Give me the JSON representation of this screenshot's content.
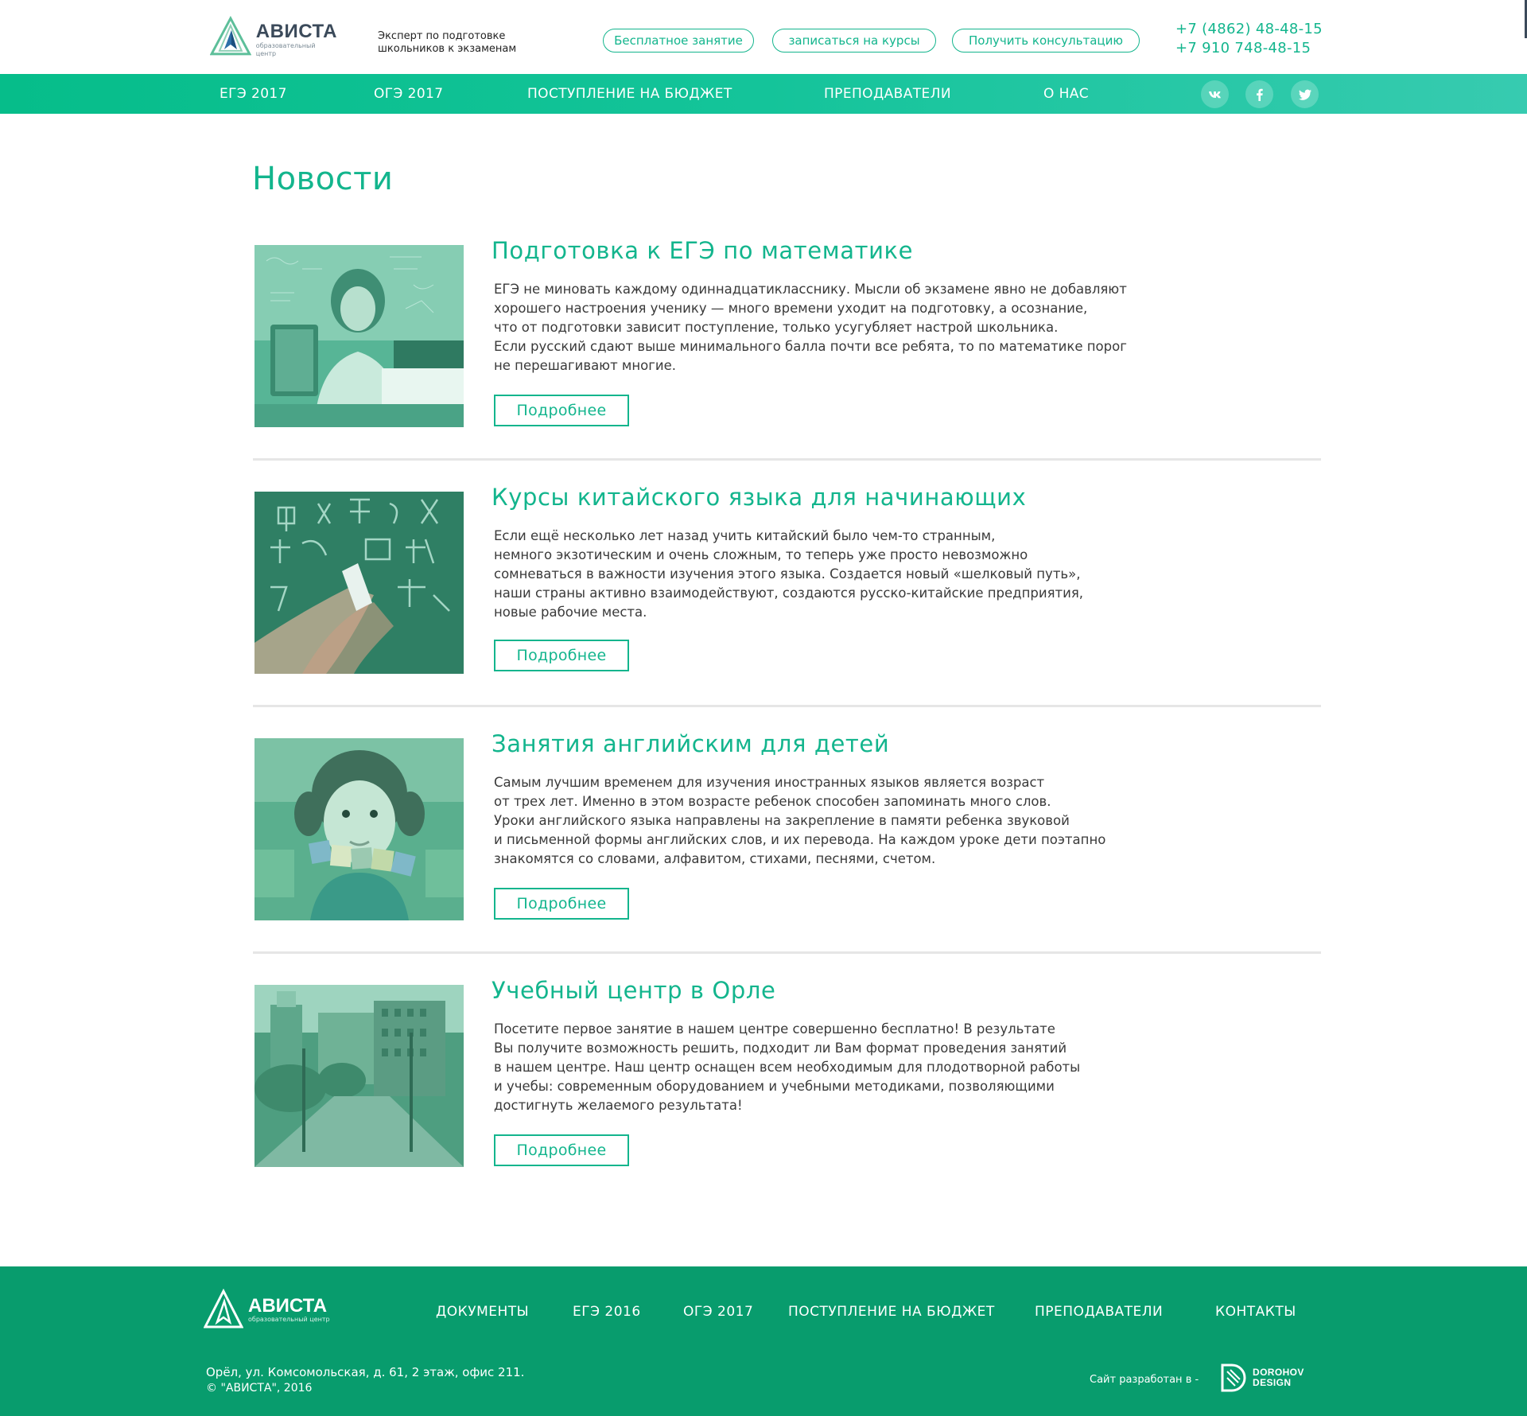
{
  "header": {
    "logo_name": "АВИСТА",
    "logo_sub": "образовательный центр",
    "tagline_line1": "Эксперт по подготовке",
    "tagline_line2": "школьников к экзаменам",
    "buttons": [
      "Бесплатное занятие",
      "записаться на курсы",
      "Получить консультацию"
    ],
    "phone1": "+7 (4862) 48-48-15",
    "phone2": "+7 910 748-48-15"
  },
  "nav": {
    "items": [
      "ЕГЭ 2017",
      "ОГЭ 2017",
      "ПОСТУПЛЕНИЕ НА БЮДЖЕТ",
      "ПРЕПОДАВАТЕЛИ",
      "О НАС"
    ],
    "social": [
      "vk-icon",
      "facebook-icon",
      "twitter-icon"
    ]
  },
  "main": {
    "title": "Новости",
    "news": [
      {
        "title": "Подготовка к ЕГЭ по математике",
        "lines": [
          "ЕГЭ не миновать каждому одиннадцатикласснику. Мысли об экзамене явно не добавляют",
          "хорошего настроения ученику — много времени уходит на подготовку, а осознание,",
          "что от подготовки зависит поступление, только усугубляет настрой школьника.",
          "Если русский сдают выше минимального балла почти все ребята, то по математике порог",
          "не перешагивают многие."
        ],
        "button": "Подробнее"
      },
      {
        "title": "Курсы китайского языка для начинающих",
        "lines": [
          "Если ещё несколько лет назад учить китайский было чем-то странным,",
          "немного экзотическим и очень сложным, то теперь уже просто невозможно",
          "сомневаться в важности изучения этого языка. Создается новый «шелковый путь»,",
          "наши страны активно взаимодействуют, создаются русско-китайские предприятия,",
          "новые рабочие места."
        ],
        "button": "Подробнее"
      },
      {
        "title": "Занятия английским для детей",
        "lines": [
          "Самым лучшим временем для изучения иностранных языков является возраст",
          "от трех лет. Именно в этом возрасте ребенок способен запоминать много слов.",
          "Уроки английского языка направлены на закрепление в памяти ребенка звуковой",
          "и письменной формы английских слов, и их перевода. На каждом уроке дети поэтапно",
          "знакомятся со словами, алфавитом, стихами, песнями, счетом."
        ],
        "button": "Подробнее"
      },
      {
        "title": "Учебный центр в Орле",
        "lines": [
          "Посетите первое занятие в нашем центре совершенно бесплатно! В результате",
          "Вы получите возможность решить, подходит ли Вам формат проведения занятий",
          "в нашем центре. Наш центр оснащен всем необходимым для плодотворной работы",
          "и учебы: современным оборудованием и учебными методиками, позволяющими",
          "достигнуть желаемого результата!"
        ],
        "button": "Подробнее"
      }
    ]
  },
  "footer": {
    "logo_name": "АВИСТА",
    "logo_sub": "образовательный центр",
    "nav": [
      "ДОКУМЕНТЫ",
      "ЕГЭ 2016",
      "ОГЭ 2017",
      "ПОСТУПЛЕНИЕ НА БЮДЖЕТ",
      "ПРЕПОДАВАТЕЛИ",
      "КОНТАКТЫ"
    ],
    "address": "Орёл, ул. Комсомольская, д. 61, 2 этаж, офис 211.",
    "copyright": "© \"АВИСТА\", 2016",
    "developed_by": "Сайт разработан в -",
    "dev_name1": "DOROHOV",
    "dev_name2": "DESIGN"
  },
  "colors": {
    "accent": "#13b58d",
    "nav_bg_start": "#06bd8a",
    "nav_bg_end": "#37cbb0",
    "footer_bg": "#089c6d",
    "logo_dark": "#3b4a5a"
  }
}
